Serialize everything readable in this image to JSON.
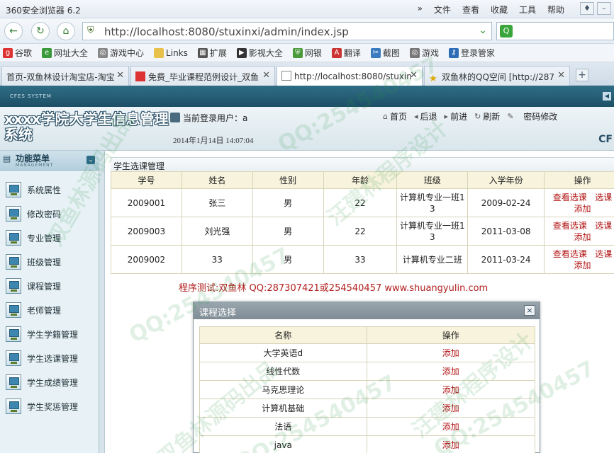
{
  "browser": {
    "title": "360安全浏览器 6.2",
    "menu": [
      "文件",
      "查看",
      "收藏",
      "工具",
      "帮助"
    ],
    "url": "http://localhost:8080/stuxinxi/admin/index.jsp",
    "favorites": [
      "谷歌",
      "网址大全",
      "游戏中心",
      "Links",
      "扩展",
      "影视大全",
      "网银",
      "翻译",
      "截图",
      "游戏",
      "登录管家"
    ],
    "tabs": [
      {
        "label": "首页-双鱼林设计淘宝店-淘宝"
      },
      {
        "label": "免费_毕业课程范例设计_双鱼"
      },
      {
        "label": "http://localhost:8080/stuxin"
      },
      {
        "label": "双鱼林的QQ空间 [http://287"
      }
    ]
  },
  "app": {
    "strip_logo": "CFES SYSTEM",
    "system_title": "xxxx学院大学生信息管理系统",
    "current_user": "当前登录用户：a",
    "datetime": "2014年1月14日  14:07:04",
    "corner_mark": "CF",
    "topnav": [
      "首页",
      "后退",
      "前进",
      "刷新",
      "密码修改"
    ]
  },
  "sidebar": {
    "title": "功能菜单",
    "subtitle": "MANAGEMENT",
    "items": [
      "系统属性",
      "修改密码",
      "专业管理",
      "班级管理",
      "课程管理",
      "老师管理",
      "学生学籍管理",
      "学生选课管理",
      "学生成绩管理",
      "学生奖惩管理"
    ]
  },
  "main": {
    "panel_title": "学生选课管理",
    "columns": [
      "学号",
      "姓名",
      "性别",
      "年龄",
      "班级",
      "入学年份",
      "操作"
    ],
    "rows": [
      {
        "id": "2009001",
        "name": "张三",
        "sex": "男",
        "age": "22",
        "class_l1": "计算机专业一班1",
        "class_l2": "3",
        "year": "2009-02-24"
      },
      {
        "id": "2009003",
        "name": "刘光强",
        "sex": "男",
        "age": "22",
        "class_l1": "计算机专业一班1",
        "class_l2": "3",
        "year": "2011-03-08"
      },
      {
        "id": "2009002",
        "name": "33",
        "sex": "男",
        "age": "33",
        "class_l1": "计算机专业二班",
        "class_l2": "",
        "year": "2011-03-24"
      }
    ],
    "op_view": "查看选课",
    "op_select": "选课",
    "op_add": "添加",
    "test_line": "程序测试:双鱼林 QQ:287307421或254540457 www.shuangyulin.com"
  },
  "dialog": {
    "title": "课程选择",
    "close": "×",
    "columns": [
      "名称",
      "操作"
    ],
    "rows": [
      {
        "name": "大学英语d",
        "op": "添加"
      },
      {
        "name": "线性代数",
        "op": "添加"
      },
      {
        "name": "马克思理论",
        "op": "添加"
      },
      {
        "name": "计算机基础",
        "op": "添加"
      },
      {
        "name": "法语",
        "op": "添加"
      },
      {
        "name": "java",
        "op": "添加"
      }
    ]
  },
  "watermarks": [
    "QQ:254540457",
    "双鱼林源码出品",
    "汪建林程序设计",
    "QQ:254540457",
    "双鱼林源码出品",
    "汪建林程序设计",
    "QQ:254540457",
    "QQ:254540457"
  ]
}
